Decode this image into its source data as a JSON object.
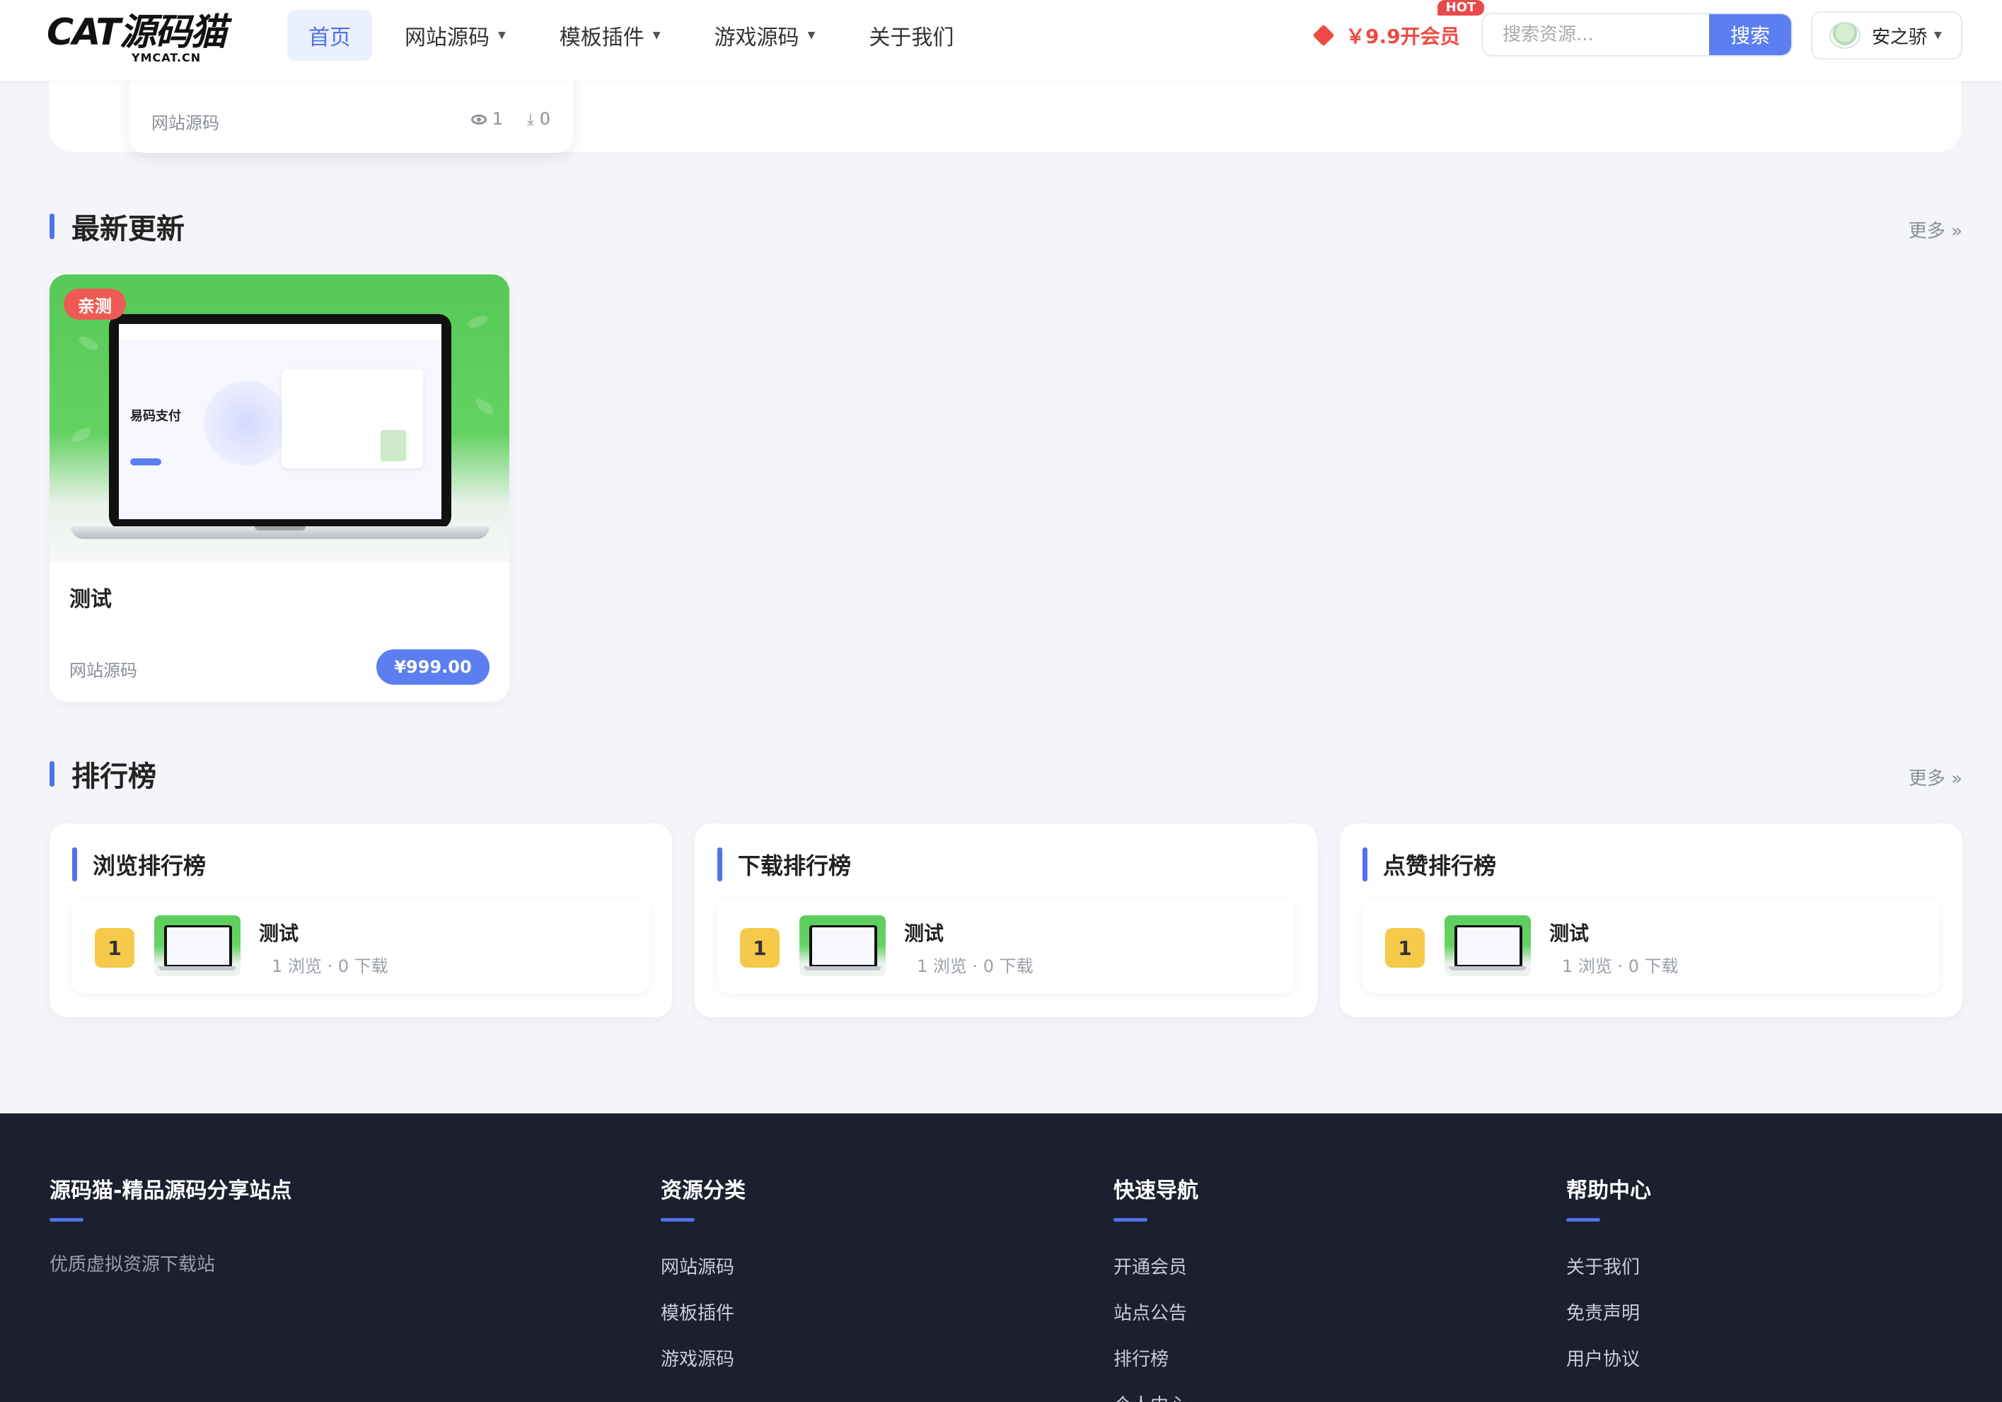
{
  "logo": {
    "main": "CAT源码猫",
    "sub": "YMCAT.CN"
  },
  "nav": [
    {
      "label": "首页",
      "dropdown": false,
      "active": true
    },
    {
      "label": "网站源码",
      "dropdown": true,
      "active": false
    },
    {
      "label": "模板插件",
      "dropdown": true,
      "active": false
    },
    {
      "label": "游戏源码",
      "dropdown": true,
      "active": false
    },
    {
      "label": "关于我们",
      "dropdown": false,
      "active": false
    }
  ],
  "header": {
    "vip_label": "￥9.9开会员",
    "hot_badge": "HOT",
    "search_placeholder": "搜索资源...",
    "search_button": "搜索",
    "user_name": "安之骄"
  },
  "top_card": {
    "category": "网站源码",
    "views": "1",
    "downloads": "0"
  },
  "latest": {
    "section_title": "最新更新",
    "more": "更多 »",
    "card": {
      "badge": "亲测",
      "title": "测试",
      "category": "网站源码",
      "price": "¥999.00",
      "thumb_text": "易码支付"
    }
  },
  "ranking": {
    "section_title": "排行榜",
    "more": "更多 »",
    "boards": [
      {
        "title": "浏览排行榜",
        "items": [
          {
            "rank": "1",
            "name": "测试",
            "meta": "1 浏览 · 0 下载"
          }
        ]
      },
      {
        "title": "下载排行榜",
        "items": [
          {
            "rank": "1",
            "name": "测试",
            "meta": "1 浏览 · 0 下载"
          }
        ]
      },
      {
        "title": "点赞排行榜",
        "items": [
          {
            "rank": "1",
            "name": "测试",
            "meta": "1 浏览 · 0 下载"
          }
        ]
      }
    ]
  },
  "footer": {
    "about": {
      "title": "源码猫-精品源码分享站点",
      "desc": "优质虚拟资源下载站"
    },
    "categories": {
      "title": "资源分类",
      "links": [
        "网站源码",
        "模板插件",
        "游戏源码"
      ]
    },
    "quick_nav": {
      "title": "快速导航",
      "links": [
        "开通会员",
        "站点公告",
        "排行榜",
        "个人中心"
      ]
    },
    "help": {
      "title": "帮助中心",
      "links": [
        "关于我们",
        "免责声明",
        "用户协议"
      ]
    }
  },
  "colors": {
    "accent": "#4f73e8",
    "button": "#5b7ff0",
    "hot": "#e84a4a",
    "vip": "#ef4a43",
    "footer_bg": "#1b1f2e",
    "rank_gold": "#f6c94a"
  }
}
